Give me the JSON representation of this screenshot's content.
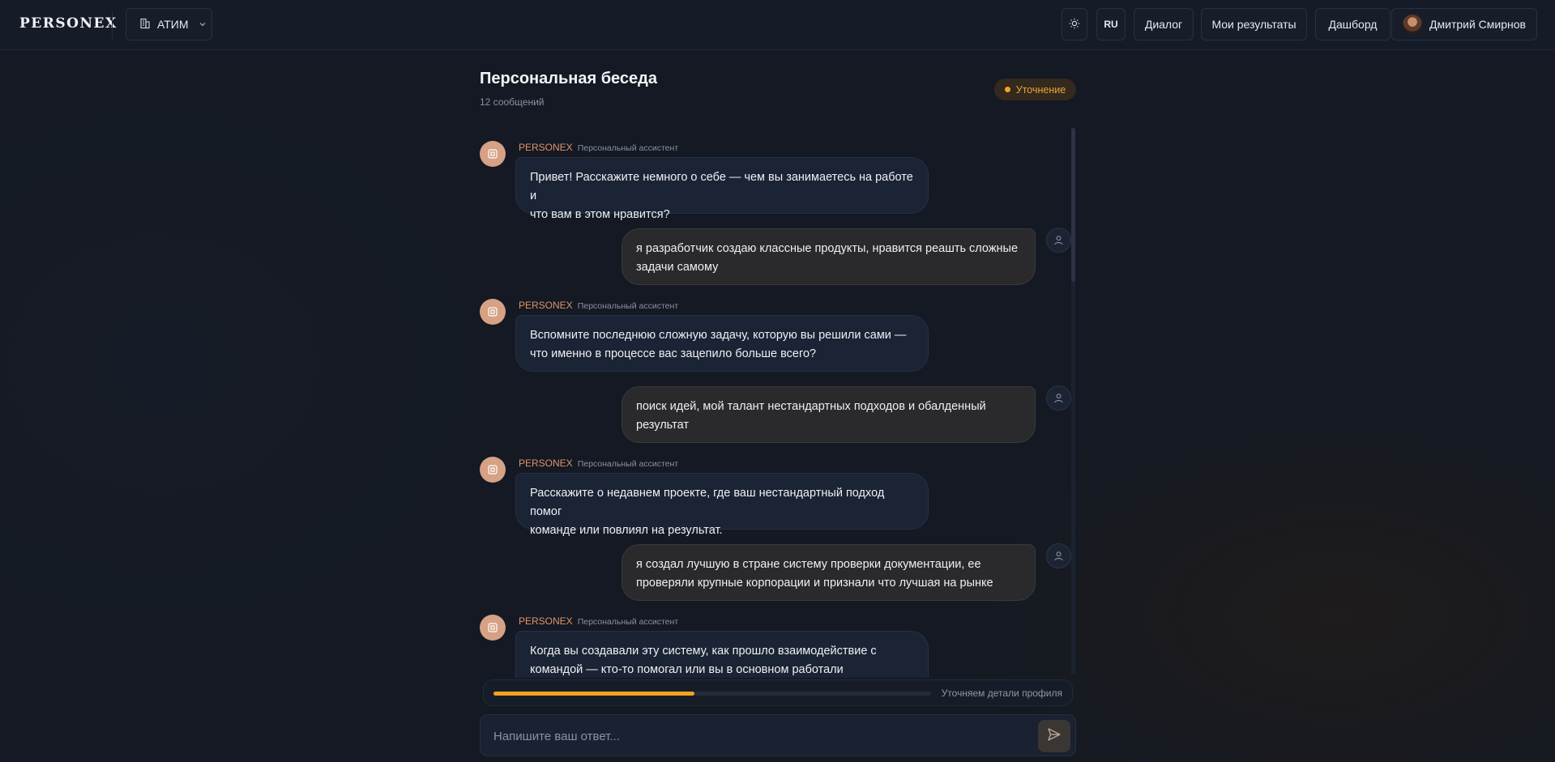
{
  "header": {
    "logo": "PERSONEX",
    "org_select": {
      "value": "АТИМ"
    },
    "lang": "RU",
    "nav": [
      "Диалог",
      "Мои результаты",
      "Дашборд"
    ],
    "user_name": "Дмитрий Смирнов"
  },
  "conversation": {
    "title": "Персональная беседа",
    "subtitle": "12 сообщений",
    "status": "Уточнение"
  },
  "messages": [
    {
      "role": "bot",
      "sender": "PERSONEX",
      "sender_role": "Персональный ассистент",
      "lines": [
        "Привет! Расскажите немного о себе — чем вы занимаетесь на работе и",
        "что вам в этом нравится?"
      ]
    },
    {
      "role": "user",
      "lines": [
        "я разработчик создаю классные продукты, нравится реашть сложные",
        "задачи самому"
      ]
    },
    {
      "role": "bot",
      "sender": "PERSONEX",
      "sender_role": "Персональный ассистент",
      "lines": [
        "Вспомните последнюю сложную задачу, которую вы решили сами —",
        "что именно в процессе вас зацепило больше всего?"
      ]
    },
    {
      "role": "user",
      "lines": [
        "поиск идей, мой талант нестандартных подходов и обалденный",
        "результат"
      ]
    },
    {
      "role": "bot",
      "sender": "PERSONEX",
      "sender_role": "Персональный ассистент",
      "lines": [
        "Расскажите о недавнем проекте, где ваш нестандартный подход помог",
        "команде или повлиял на результат."
      ]
    },
    {
      "role": "user",
      "lines": [
        "я создал лучшую в стране систему проверки документации, ее",
        "проверяли крупные корпорации и признали что лучшая на рынке"
      ]
    },
    {
      "role": "bot",
      "sender": "PERSONEX",
      "sender_role": "Персональный ассистент",
      "lines": [
        "Когда вы создавали эту систему, как прошло взаимодействие с",
        "командой — кто-то помогал или вы в основном работали"
      ]
    }
  ],
  "progress": {
    "fraction": 0.46,
    "label": "Уточняем детали профиля"
  },
  "composer": {
    "placeholder": "Напишите ваш ответ..."
  },
  "colors": {
    "accent": "#f4a21c",
    "bot_name": "#e0936a",
    "background": "#141923"
  },
  "icons": {
    "org": "building-icon",
    "chevron": "chevron-down-icon",
    "theme": "sun-icon",
    "bot": "assistant-icon",
    "user": "user-icon",
    "send": "send-icon"
  }
}
